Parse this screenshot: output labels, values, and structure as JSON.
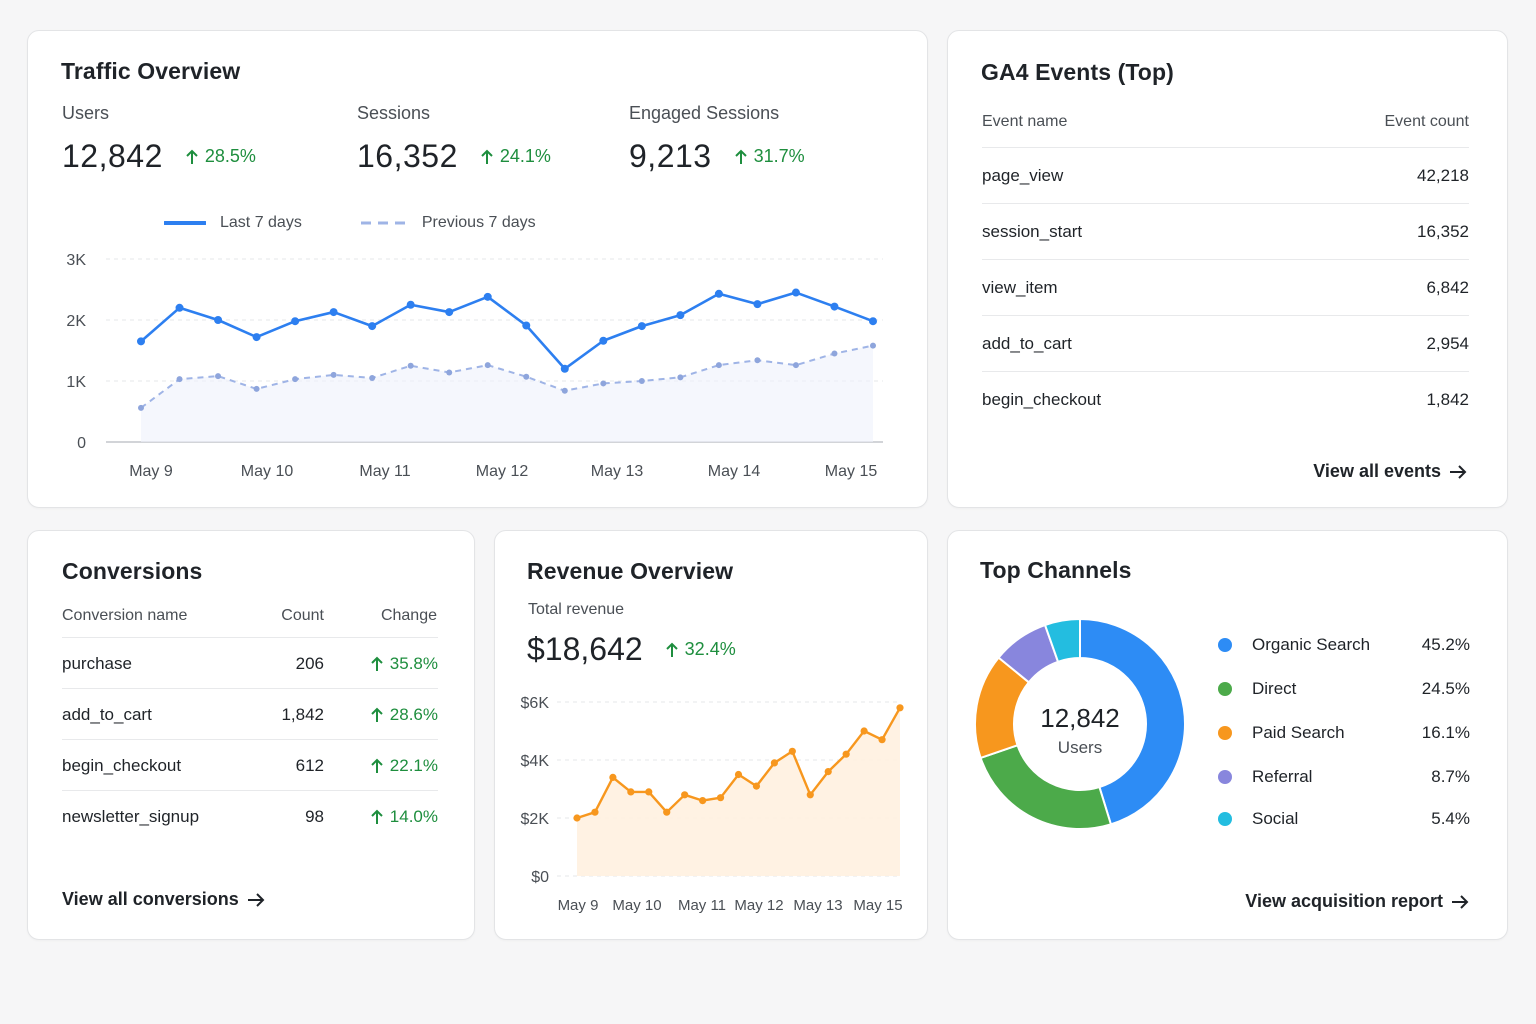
{
  "colors": {
    "blue": "#2d7ff0",
    "blue_dashed": "#9fb4e6",
    "orange": "#f7971e",
    "green": "#1e8e3e",
    "grid": "#e6e7ea"
  },
  "traffic": {
    "title": "Traffic Overview",
    "kpis": [
      {
        "label": "Users",
        "value": "12,842",
        "change": "28.5%"
      },
      {
        "label": "Sessions",
        "value": "16,352",
        "change": "24.1%"
      },
      {
        "label": "Engaged Sessions",
        "value": "9,213",
        "change": "31.7%"
      }
    ],
    "legend": {
      "current": "Last 7 days",
      "previous": "Previous 7 days"
    }
  },
  "events": {
    "title": "GA4 Events (Top)",
    "col_name": "Event name",
    "col_count": "Event count",
    "rows": [
      {
        "name": "page_view",
        "count": "42,218"
      },
      {
        "name": "session_start",
        "count": "16,352"
      },
      {
        "name": "view_item",
        "count": "6,842"
      },
      {
        "name": "add_to_cart",
        "count": "2,954"
      },
      {
        "name": "begin_checkout",
        "count": "1,842"
      }
    ],
    "link": "View all events"
  },
  "conversions": {
    "title": "Conversions",
    "col_name": "Conversion name",
    "col_count": "Count",
    "col_change": "Change",
    "rows": [
      {
        "name": "purchase",
        "count": "206",
        "change": "35.8%"
      },
      {
        "name": "add_to_cart",
        "count": "1,842",
        "change": "28.6%"
      },
      {
        "name": "begin_checkout",
        "count": "612",
        "change": "22.1%"
      },
      {
        "name": "newsletter_signup",
        "count": "98",
        "change": "14.0%"
      }
    ],
    "link": "View all conversions"
  },
  "revenue": {
    "title": "Revenue Overview",
    "label": "Total revenue",
    "value": "$18,642",
    "change": "32.4%"
  },
  "channels": {
    "title": "Top Channels",
    "center_value": "12,842",
    "center_label": "Users",
    "items": [
      {
        "name": "Organic Search",
        "pct": "45.2%",
        "value": 45.2,
        "color": "#2d8cf5"
      },
      {
        "name": "Direct",
        "pct": "24.5%",
        "value": 24.5,
        "color": "#4caa4a"
      },
      {
        "name": "Paid Search",
        "pct": "16.1%",
        "value": 16.1,
        "color": "#f7971e"
      },
      {
        "name": "Referral",
        "pct": "8.7%",
        "value": 8.7,
        "color": "#8886dd"
      },
      {
        "name": "Social",
        "pct": "5.4%",
        "value": 5.4,
        "color": "#23bde0"
      }
    ],
    "link": "View acquisition report"
  },
  "chart_data": [
    {
      "type": "line",
      "title": "",
      "categories": [
        "May 9",
        "May 10",
        "May 11",
        "May 12",
        "May 13",
        "May 14",
        "May 15"
      ],
      "y_ticks": [
        "0",
        "1K",
        "2K",
        "3K"
      ],
      "ylim": [
        0,
        3000
      ],
      "grid": true,
      "legend": "top-left",
      "series": [
        {
          "name": "Last 7 days",
          "style": "solid",
          "values": [
            1650,
            2200,
            2000,
            1720,
            1980,
            2130,
            1900,
            2250,
            2130,
            2380,
            1910,
            1200,
            1660,
            1900,
            2080,
            2430,
            2260,
            2450,
            2220,
            1980
          ]
        },
        {
          "name": "Previous 7 days",
          "style": "dashed",
          "values": [
            560,
            1030,
            1080,
            870,
            1030,
            1100,
            1050,
            1250,
            1140,
            1260,
            1070,
            840,
            960,
            1000,
            1060,
            1260,
            1340,
            1260,
            1450,
            1580
          ]
        }
      ]
    },
    {
      "type": "area",
      "title": "",
      "categories": [
        "May 9",
        "May 10",
        "May 11",
        "May 12",
        "May 13",
        "May 14",
        "May 15"
      ],
      "y_ticks": [
        "$0",
        "$2K",
        "$4K",
        "$6K"
      ],
      "ylim": [
        0,
        6000
      ],
      "grid": true,
      "series": [
        {
          "values": [
            2000,
            2200,
            3400,
            2900,
            2900,
            2200,
            2800,
            2600,
            2700,
            3500,
            3100,
            3900,
            4300,
            2800,
            3600,
            4200,
            5000,
            4700,
            5800
          ]
        }
      ]
    }
  ]
}
